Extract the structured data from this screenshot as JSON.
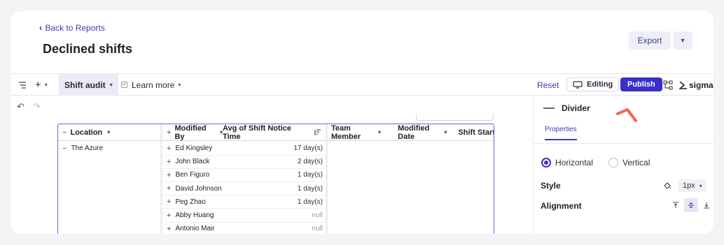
{
  "header": {
    "back_label": "Back to Reports",
    "page_title": "Declined shifts",
    "export_label": "Export"
  },
  "toolbar": {
    "active_tab": "Shift audit",
    "learn_more": "Learn more",
    "reset": "Reset",
    "editing": "Editing",
    "publish": "Publish",
    "brand": "sigma"
  },
  "table": {
    "columns": [
      "Location",
      "Modified By",
      "Avg of Shift Notice Time",
      "Team Member",
      "Modified Date",
      "Shift Start"
    ],
    "location": "The Azure",
    "rows": [
      {
        "name": "Ed Kingsley",
        "notice": "17 day(s)"
      },
      {
        "name": "John Black",
        "notice": "2 day(s)"
      },
      {
        "name": "Ben Figuro",
        "notice": "1 day(s)"
      },
      {
        "name": "David Johnson",
        "notice": "1 day(s)"
      },
      {
        "name": "Peg Zhao",
        "notice": "1 day(s)"
      },
      {
        "name": "Abby Huang",
        "notice": "null"
      },
      {
        "name": "Antonio Mair",
        "notice": "null"
      }
    ]
  },
  "panel": {
    "element_type": "Divider",
    "tab": "Properties",
    "orientation_options": [
      "Horizontal",
      "Vertical"
    ],
    "selected_orientation": "Horizontal",
    "style_label": "Style",
    "style_value": "1px",
    "alignment_label": "Alignment"
  },
  "colors": {
    "accent": "#3b2fc9",
    "link": "#3b3bb3",
    "annotation_arrow": "#f0645a"
  }
}
